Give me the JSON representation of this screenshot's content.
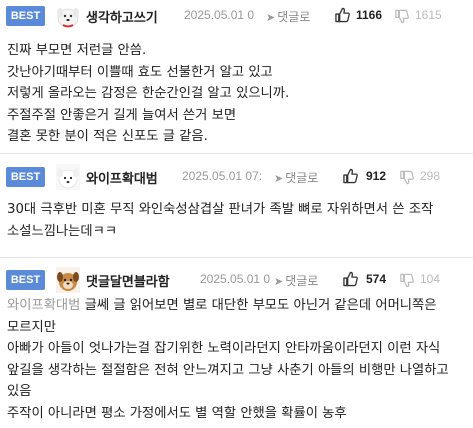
{
  "comments": [
    {
      "badge": "BEST",
      "nickname": "생각하고쓰기",
      "date": "2025.05.01 0",
      "reply_label": "댓글로",
      "upvotes": "1166",
      "downvotes": "1615",
      "avatar": "dog-avatar",
      "mention": "",
      "text": "진짜 부모면 저런글 안씀.\n갓난아기때부터 이쁠때 효도 선불한거 알고 있고\n저렇게 올라오는 감정은 한순간인걸 알고 있으니까.\n주절주절 안좋은거 길게 늘여서 쓴거 보면\n결혼 못한 분이 적은 신포도 글 같음."
    },
    {
      "badge": "BEST",
      "nickname": "와이프확대범",
      "date": "2025.05.01 07:",
      "reply_label": "댓글로",
      "upvotes": "912",
      "downvotes": "298",
      "avatar": "white-puppy-avatar",
      "mention": "",
      "text": "30대 극후반 미혼 무직 와인숙성삼겹살 판녀가 족발 뼈로 자위하면서 쓴 조작 소설느낌나는데ㅋㅋ"
    },
    {
      "badge": "BEST",
      "nickname": "댓글달면블라함",
      "date": "2025.05.01 0",
      "reply_label": "댓글로",
      "upvotes": "574",
      "downvotes": "104",
      "avatar": "brown-puppy-avatar",
      "mention": "와이프확대범",
      "text": " 글쎄 글 읽어보면 별로 대단한 부모도 아닌거 같은데 어머니쪽은 모르지만\n아빠가 아들이 엇나가는걸 잡기위한 노력이라던지 안타까움이라던지 이런 자식 앞길을 생각하는 절절함은 전혀 안느껴지고 그냥 사춘기 아들의 비행만 나열하고 있음\n주작이 아니라면 평소 가정에서도 별 역할 안했을 확률이 농후"
    }
  ],
  "colors": {
    "badge_bg": "#5b8ad8",
    "text": "#222222",
    "muted": "#999999",
    "thumb_up": "#333333",
    "thumb_down": "#bbbbbb"
  }
}
